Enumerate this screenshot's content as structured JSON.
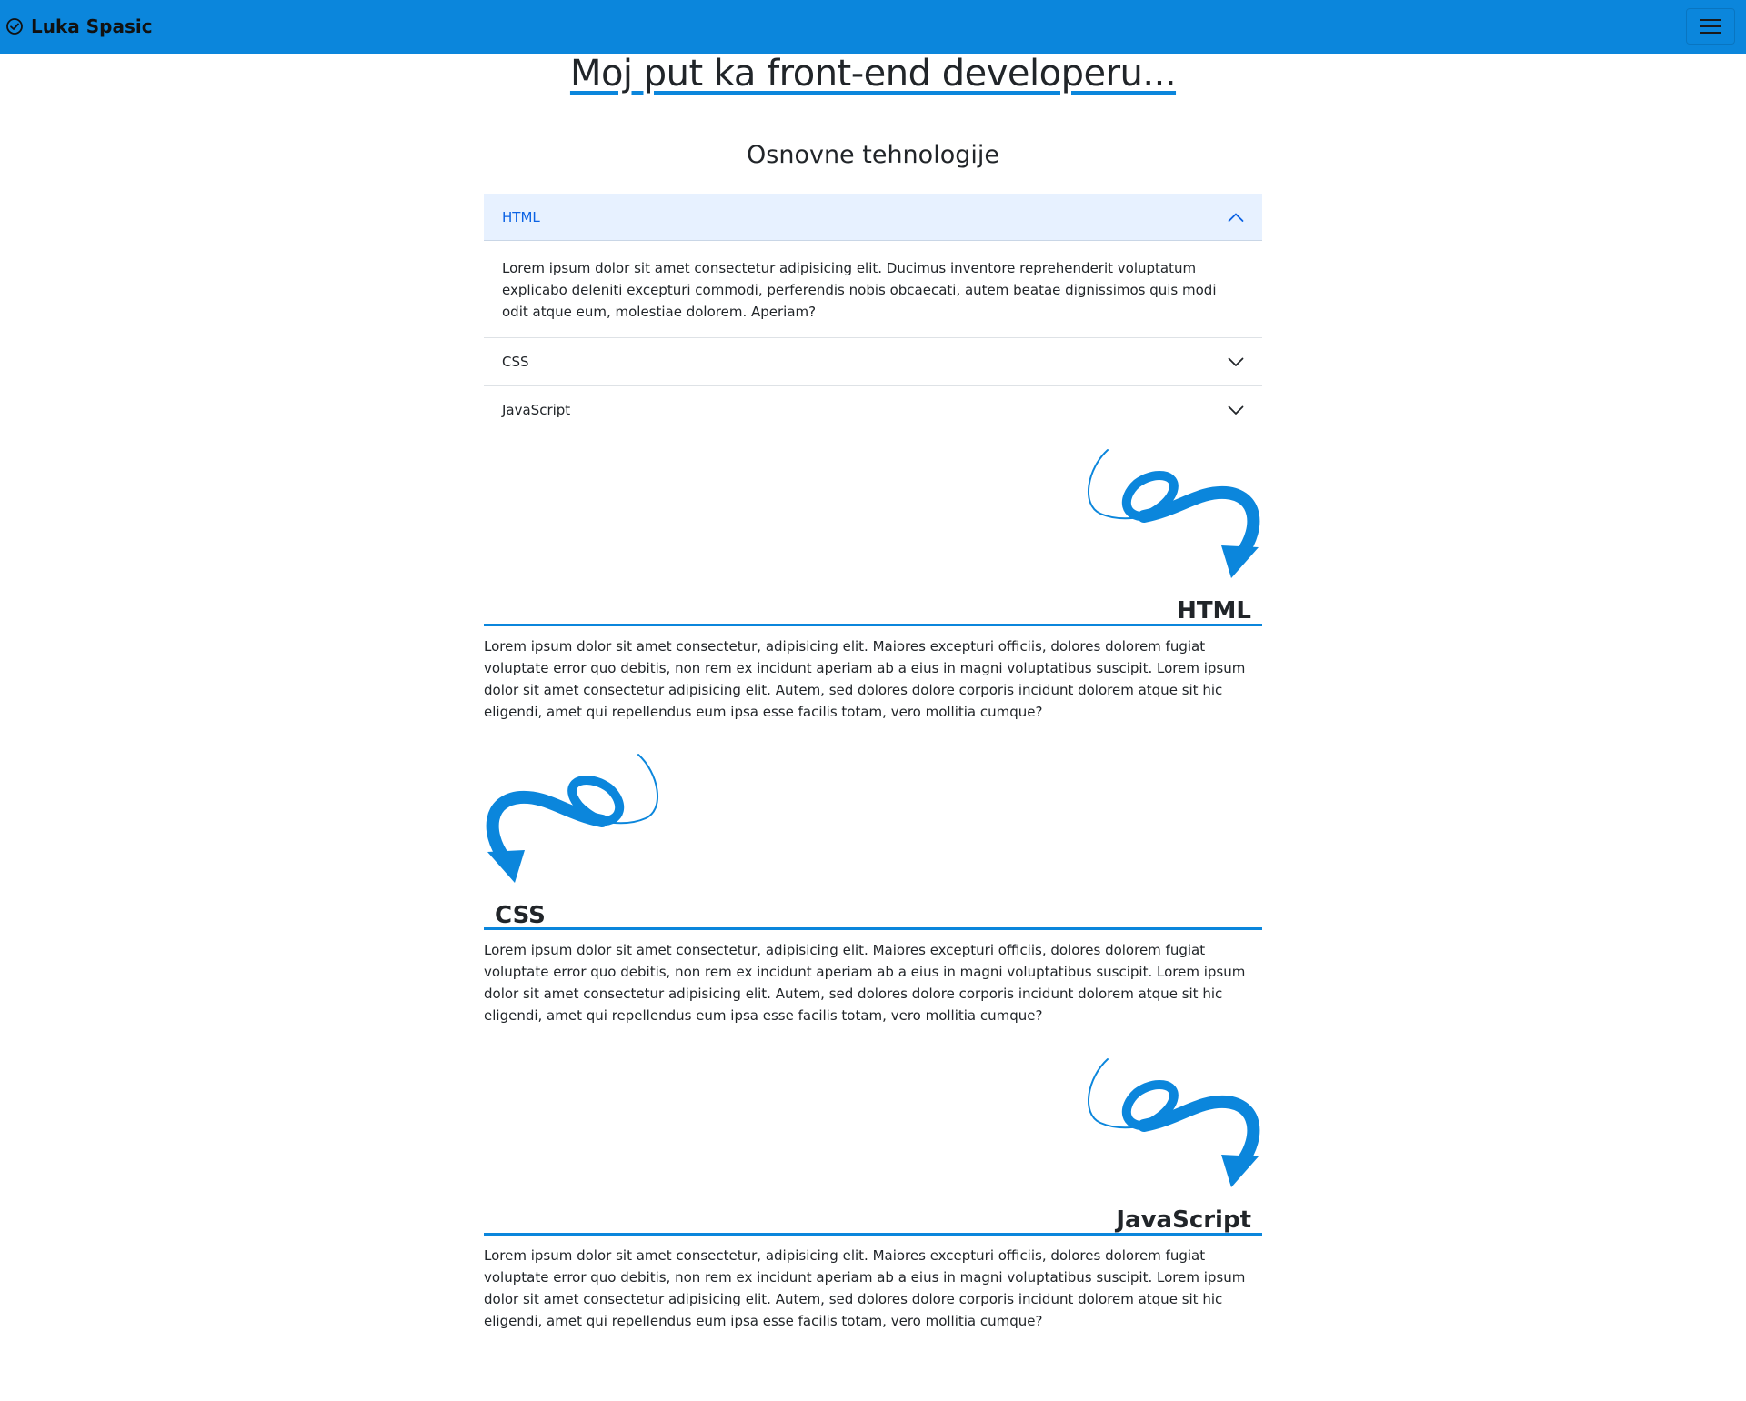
{
  "navbar": {
    "brand": "Luka Spasic",
    "brand_icon": "check-circle-icon",
    "toggler_icon": "hamburger-menu-icon",
    "background": "#0b86dc"
  },
  "page": {
    "title": "Moj put ka front-end developeru...",
    "subtitle": "Osnovne tehnologije"
  },
  "accordion": {
    "items": [
      {
        "label": "HTML",
        "expanded": true,
        "body": "Lorem ipsum dolor sit amet consectetur adipisicing elit. Ducimus inventore reprehenderit voluptatum explicabo deleniti excepturi commodi, perferendis nobis obcaecati, autem beatae dignissimos quis modi odit atque eum, molestiae dolorem. Aperiam?"
      },
      {
        "label": "CSS",
        "expanded": false
      },
      {
        "label": "JavaScript",
        "expanded": false
      }
    ]
  },
  "sections": [
    {
      "heading": "HTML",
      "arrow_icon": "curly-arrow-icon",
      "text": "Lorem ipsum dolor sit amet consectetur, adipisicing elit. Maiores excepturi officiis, dolores dolorem fugiat voluptate error quo debitis, non rem ex incidunt aperiam ab a eius in magni voluptatibus suscipit. Lorem ipsum dolor sit amet consectetur adipisicing elit. Autem, sed dolores dolore corporis incidunt dolorem atque sit hic eligendi, amet qui repellendus eum ipsa esse facilis totam, vero mollitia cumque?"
    },
    {
      "heading": "CSS",
      "arrow_icon": "curly-arrow-icon",
      "text": "Lorem ipsum dolor sit amet consectetur, adipisicing elit. Maiores excepturi officiis, dolores dolorem fugiat voluptate error quo debitis, non rem ex incidunt aperiam ab a eius in magni voluptatibus suscipit. Lorem ipsum dolor sit amet consectetur adipisicing elit. Autem, sed dolores dolore corporis incidunt dolorem atque sit hic eligendi, amet qui repellendus eum ipsa esse facilis totam, vero mollitia cumque?"
    },
    {
      "heading": "JavaScript",
      "arrow_icon": "curly-arrow-icon",
      "text": "Lorem ipsum dolor sit amet consectetur, adipisicing elit. Maiores excepturi officiis, dolores dolorem fugiat voluptate error quo debitis, non rem ex incidunt aperiam ab a eius in magni voluptatibus suscipit. Lorem ipsum dolor sit amet consectetur adipisicing elit. Autem, sed dolores dolore corporis incidunt dolorem atque sit hic eligendi, amet qui repellendus eum ipsa esse facilis totam, vero mollitia cumque?"
    }
  ],
  "colors": {
    "accent": "#0b86dc",
    "accordion_open_bg": "#e7f1ff",
    "accordion_open_text": "#0c63e4"
  }
}
